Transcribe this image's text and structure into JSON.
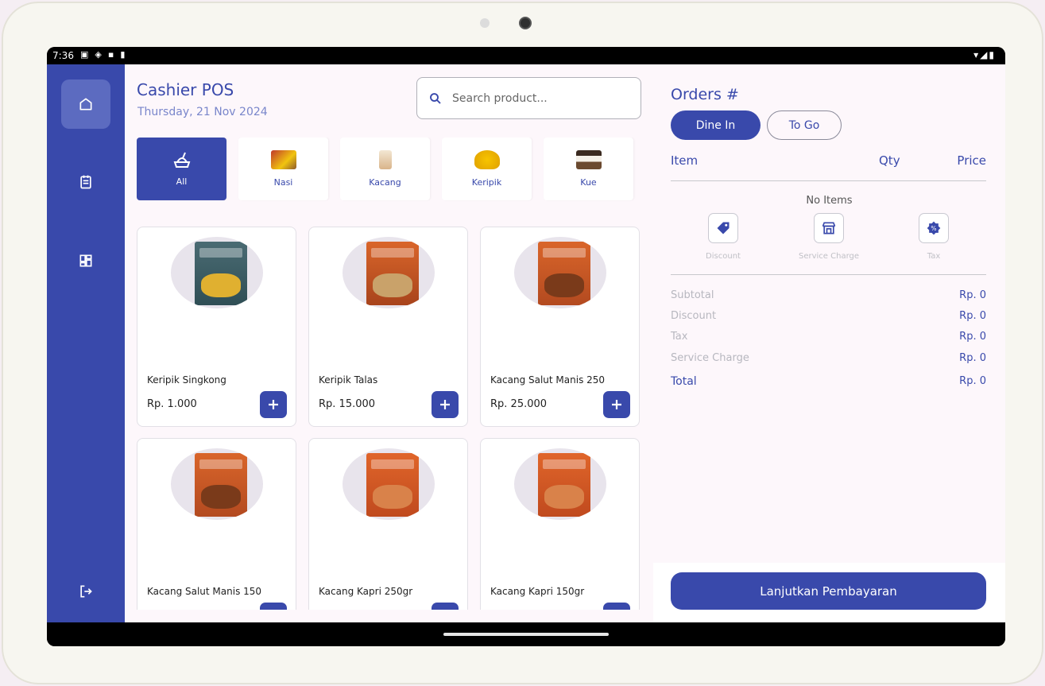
{
  "status": {
    "time": "7:36"
  },
  "header": {
    "title": "Cashier POS",
    "date": "Thursday, 21 Nov 2024"
  },
  "search": {
    "placeholder": "Search product..."
  },
  "sidebar": {
    "items": [
      "home-icon",
      "clipboard-icon",
      "dashboard-icon",
      "logout-icon"
    ],
    "active": "home-icon"
  },
  "categories": [
    {
      "label": "All",
      "active": true
    },
    {
      "label": "Nasi"
    },
    {
      "label": "Kacang"
    },
    {
      "label": "Keripik"
    },
    {
      "label": "Kue"
    }
  ],
  "products": [
    {
      "name": "Keripik Singkong",
      "price": "Rp. 1.000"
    },
    {
      "name": "Keripik Talas",
      "price": "Rp. 15.000"
    },
    {
      "name": "Kacang Salut Manis 250",
      "price": "Rp. 25.000"
    },
    {
      "name": "Kacang Salut Manis 150",
      "price": ""
    },
    {
      "name": "Kacang Kapri 250gr",
      "price": ""
    },
    {
      "name": "Kacang Kapri 150gr",
      "price": ""
    }
  ],
  "orders": {
    "title": "Orders #",
    "dine_in": "Dine In",
    "to_go": "To Go",
    "col_item": "Item",
    "col_qty": "Qty",
    "col_price": "Price",
    "empty": "No Items",
    "options": {
      "discount": "Discount",
      "service": "Service Charge",
      "tax": "Tax"
    },
    "summary": {
      "subtotal_label": "Subtotal",
      "subtotal": "Rp. 0",
      "discount_label": "Discount",
      "discount": "Rp. 0",
      "tax_label": "Tax",
      "tax": "Rp. 0",
      "service_label": "Service Charge",
      "service": "Rp. 0",
      "total_label": "Total",
      "total": "Rp. 0"
    },
    "pay_button": "Lanjutkan Pembayaran"
  },
  "colors": {
    "primary": "#3949ab",
    "sidebar_active": "#5c6bc0",
    "background": "#fdf7fb"
  }
}
